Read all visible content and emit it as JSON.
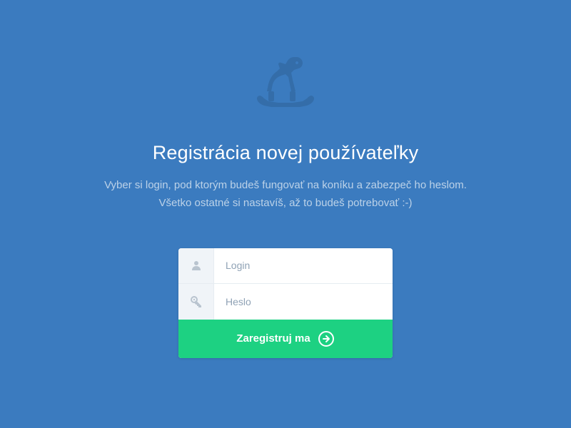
{
  "logo": {
    "name": "rocking-horse"
  },
  "heading": "Registrácia novej používateľky",
  "subheading_line1": "Vyber si login, pod ktorým budeš fungovať na koníku a zabezpeč ho heslom.",
  "subheading_line2": "Všetko ostatné si nastavíš, až to budeš potrebovať :-)",
  "form": {
    "login": {
      "placeholder": "Login",
      "value": ""
    },
    "password": {
      "placeholder": "Heslo",
      "value": ""
    },
    "submit_label": "Zaregistruj ma"
  },
  "colors": {
    "background": "#3b7bbf",
    "accent": "#1dd182",
    "text_light": "#ffffff",
    "text_muted": "#bcd2e8"
  }
}
